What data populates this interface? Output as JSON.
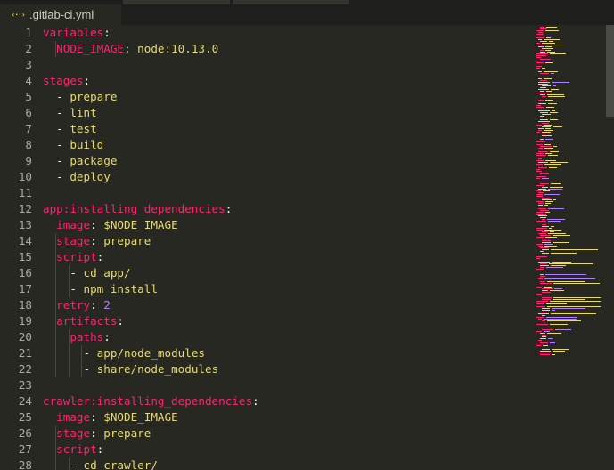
{
  "tab": {
    "label": ".gitlab-ci.yml",
    "icon": "yaml-file-icon"
  },
  "colors": {
    "background": "#272822",
    "key": "#f92672",
    "punct": "#f8f8f2",
    "string": "#e6db74",
    "number": "#ae81ff",
    "line_number": "#a9a9a0"
  },
  "lines": [
    {
      "n": "1",
      "tokens": [
        [
          "k",
          "variables"
        ],
        [
          "p",
          ":"
        ]
      ]
    },
    {
      "n": "2",
      "tokens": [
        [
          "p",
          "  "
        ],
        [
          "k",
          "NODE_IMAGE"
        ],
        [
          "p",
          ": "
        ],
        [
          "s",
          "node:10.13.0"
        ]
      ]
    },
    {
      "n": "3",
      "tokens": []
    },
    {
      "n": "4",
      "tokens": [
        [
          "k",
          "stages"
        ],
        [
          "p",
          ":"
        ]
      ]
    },
    {
      "n": "5",
      "tokens": [
        [
          "p",
          "  - "
        ],
        [
          "s",
          "prepare"
        ]
      ]
    },
    {
      "n": "6",
      "tokens": [
        [
          "p",
          "  - "
        ],
        [
          "s",
          "lint"
        ]
      ]
    },
    {
      "n": "7",
      "tokens": [
        [
          "p",
          "  - "
        ],
        [
          "s",
          "test"
        ]
      ]
    },
    {
      "n": "8",
      "tokens": [
        [
          "p",
          "  - "
        ],
        [
          "s",
          "build"
        ]
      ]
    },
    {
      "n": "9",
      "tokens": [
        [
          "p",
          "  - "
        ],
        [
          "s",
          "package"
        ]
      ]
    },
    {
      "n": "10",
      "tokens": [
        [
          "p",
          "  - "
        ],
        [
          "s",
          "deploy"
        ]
      ]
    },
    {
      "n": "11",
      "tokens": []
    },
    {
      "n": "12",
      "tokens": [
        [
          "k",
          "app:installing_dependencies"
        ],
        [
          "p",
          ":"
        ]
      ]
    },
    {
      "n": "13",
      "tokens": [
        [
          "p",
          "  "
        ],
        [
          "k",
          "image"
        ],
        [
          "p",
          ": "
        ],
        [
          "s",
          "$NODE_IMAGE"
        ]
      ]
    },
    {
      "n": "14",
      "tokens": [
        [
          "p",
          "  "
        ],
        [
          "k",
          "stage"
        ],
        [
          "p",
          ": "
        ],
        [
          "s",
          "prepare"
        ]
      ]
    },
    {
      "n": "15",
      "tokens": [
        [
          "p",
          "  "
        ],
        [
          "k",
          "script"
        ],
        [
          "p",
          ":"
        ]
      ]
    },
    {
      "n": "16",
      "tokens": [
        [
          "p",
          "    - "
        ],
        [
          "s",
          "cd app/"
        ]
      ]
    },
    {
      "n": "17",
      "tokens": [
        [
          "p",
          "    - "
        ],
        [
          "s",
          "npm install"
        ]
      ]
    },
    {
      "n": "18",
      "tokens": [
        [
          "p",
          "  "
        ],
        [
          "k",
          "retry"
        ],
        [
          "p",
          ": "
        ],
        [
          "n",
          "2"
        ]
      ]
    },
    {
      "n": "19",
      "tokens": [
        [
          "p",
          "  "
        ],
        [
          "k",
          "artifacts"
        ],
        [
          "p",
          ":"
        ]
      ]
    },
    {
      "n": "20",
      "tokens": [
        [
          "p",
          "    "
        ],
        [
          "k",
          "paths"
        ],
        [
          "p",
          ":"
        ]
      ]
    },
    {
      "n": "21",
      "tokens": [
        [
          "p",
          "      - "
        ],
        [
          "s",
          "app/node_modules"
        ]
      ]
    },
    {
      "n": "22",
      "tokens": [
        [
          "p",
          "      - "
        ],
        [
          "s",
          "share/node_modules"
        ]
      ]
    },
    {
      "n": "23",
      "tokens": []
    },
    {
      "n": "24",
      "tokens": [
        [
          "k",
          "crawler:installing_dependencies"
        ],
        [
          "p",
          ":"
        ]
      ]
    },
    {
      "n": "25",
      "tokens": [
        [
          "p",
          "  "
        ],
        [
          "k",
          "image"
        ],
        [
          "p",
          ": "
        ],
        [
          "s",
          "$NODE_IMAGE"
        ]
      ]
    },
    {
      "n": "26",
      "tokens": [
        [
          "p",
          "  "
        ],
        [
          "k",
          "stage"
        ],
        [
          "p",
          ": "
        ],
        [
          "s",
          "prepare"
        ]
      ]
    },
    {
      "n": "27",
      "tokens": [
        [
          "p",
          "  "
        ],
        [
          "k",
          "script"
        ],
        [
          "p",
          ":"
        ]
      ]
    },
    {
      "n": "28",
      "tokens": [
        [
          "p",
          "    - "
        ],
        [
          "s",
          "cd crawler/"
        ]
      ]
    }
  ]
}
